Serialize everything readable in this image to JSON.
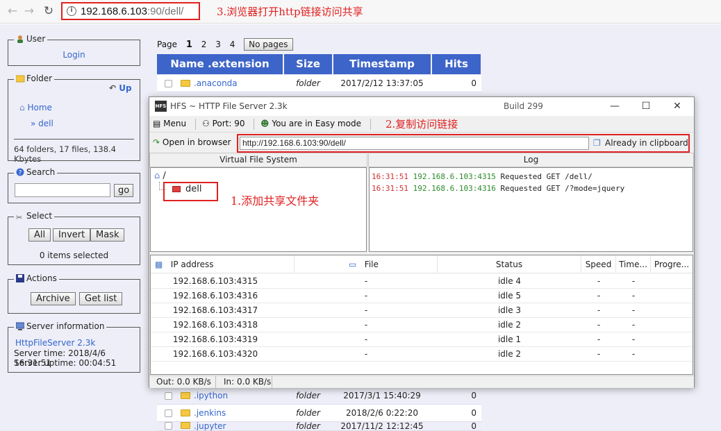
{
  "browser": {
    "url_host": "192.168.6.103",
    "url_rest": ":90/dell/",
    "annotation": "3.浏览器打开http链接访问共享"
  },
  "sidebar": {
    "user": {
      "legend": "User",
      "login": "Login"
    },
    "folder": {
      "legend": "Folder",
      "up": "Up",
      "home": "Home",
      "current": "» dell",
      "summary": "64 folders, 17 files, 138.4 Kbytes"
    },
    "search": {
      "legend": "Search",
      "go": "go",
      "value": ""
    },
    "select": {
      "legend": "Select",
      "all": "All",
      "invert": "Invert",
      "mask": "Mask",
      "selected": "0 items selected"
    },
    "actions": {
      "legend": "Actions",
      "archive": "Archive",
      "getlist": "Get list"
    },
    "server": {
      "legend": "Server information",
      "name": "HttpFileServer 2.3k",
      "time": "Server time: 2018/4/6 16:31:51",
      "uptime": "Server uptime: 00:04:51"
    }
  },
  "pager": {
    "label": "Page",
    "pages": [
      "1",
      "2",
      "3",
      "4"
    ],
    "nopages": "No pages"
  },
  "table": {
    "headers": [
      "Name .extension",
      "Size",
      "Timestamp",
      "Hits"
    ],
    "rows_top": [
      {
        "name": ".anaconda",
        "size": "folder",
        "time": "2017/2/12 13:37:05",
        "hits": "0"
      }
    ],
    "rows_bottom": [
      {
        "name": ".ipython",
        "size": "folder",
        "time": "2017/3/1 15:40:29",
        "hits": "0"
      },
      {
        "name": ".jenkins",
        "size": "folder",
        "time": "2018/2/6 0:22:20",
        "hits": "0"
      },
      {
        "name": ".jupyter",
        "size": "folder",
        "time": "2017/11/2 12:12:45",
        "hits": "0"
      }
    ]
  },
  "hfs": {
    "title": "HFS ~ HTTP File Server 2.3k",
    "build": "Build 299",
    "menu": "Menu",
    "port": "Port: 90",
    "mode": "You are in Easy mode",
    "annotation_copy": "2.复制访问链接",
    "open_browser": "Open in browser",
    "url": "http://192.168.6.103:90/dell/",
    "clipboard": "Already in clipboard",
    "vfs_head": "Virtual File System",
    "log_head": "Log",
    "vfs_root": "/",
    "vfs_item": "dell",
    "annotation_add": "1.添加共享文件夹",
    "log": [
      {
        "time": "16:31:51",
        "ip": "192.168.6.103:4315",
        "msg": "Requested GET /dell/"
      },
      {
        "time": "16:31:51",
        "ip": "192.168.6.103:4316",
        "msg": "Requested GET /?mode=jquery"
      }
    ],
    "conn_headers": [
      "IP address",
      "File",
      "Status",
      "Speed",
      "Time...",
      "Progre..."
    ],
    "connections": [
      {
        "ip": "192.168.6.103:4315",
        "file": "-",
        "status": "idle 4",
        "speed": "-",
        "time": "-"
      },
      {
        "ip": "192.168.6.103:4316",
        "file": "-",
        "status": "idle 5",
        "speed": "-",
        "time": "-"
      },
      {
        "ip": "192.168.6.103:4317",
        "file": "-",
        "status": "idle 3",
        "speed": "-",
        "time": "-"
      },
      {
        "ip": "192.168.6.103:4318",
        "file": "-",
        "status": "idle 2",
        "speed": "-",
        "time": "-"
      },
      {
        "ip": "192.168.6.103:4319",
        "file": "-",
        "status": "idle 1",
        "speed": "-",
        "time": "-"
      },
      {
        "ip": "192.168.6.103:4320",
        "file": "-",
        "status": "idle 2",
        "speed": "-",
        "time": "-"
      }
    ],
    "out": "Out: 0.0 KB/s",
    "in": "In: 0.0 KB/s"
  }
}
